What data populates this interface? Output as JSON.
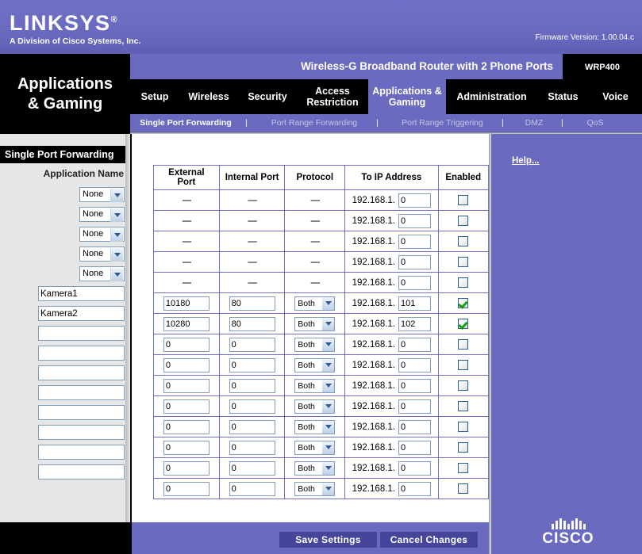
{
  "brand": {
    "name": "LINKSYS",
    "registered": "®",
    "tagline": "A Division of Cisco Systems, Inc.",
    "firmware": "Firmware Version: 1.00.04.c",
    "cisco_wordmark": "CISCO",
    "banner_color": "#6a6ac0"
  },
  "product": {
    "title": "Wireless-G Broadband Router with 2 Phone Ports",
    "model": "WRP400"
  },
  "nav": {
    "tabs": [
      {
        "label": "Setup",
        "active": false
      },
      {
        "label": "Wireless",
        "active": false
      },
      {
        "label": "Security",
        "active": false
      },
      {
        "label": "Access Restriction",
        "active": false
      },
      {
        "label": "Applications & Gaming",
        "active": true
      },
      {
        "label": "Administration",
        "active": false
      },
      {
        "label": "Status",
        "active": false
      },
      {
        "label": "Voice",
        "active": false
      }
    ],
    "subtabs": [
      {
        "label": "Single Port Forwarding",
        "active": true
      },
      {
        "label": "Port Range Forwarding",
        "active": false
      },
      {
        "label": "Port Range Triggering",
        "active": false
      },
      {
        "label": "DMZ",
        "active": false
      },
      {
        "label": "QoS",
        "active": false
      }
    ],
    "separator": "|"
  },
  "sidebar": {
    "page_title_line1": "Applications",
    "page_title_line2": "& Gaming",
    "section_title": "Single Port Forwarding",
    "application_name_label": "Application Name",
    "rows": [
      {
        "type": "select",
        "value": "None"
      },
      {
        "type": "select",
        "value": "None"
      },
      {
        "type": "select",
        "value": "None"
      },
      {
        "type": "select",
        "value": "None"
      },
      {
        "type": "select",
        "value": "None"
      },
      {
        "type": "text",
        "value": "Kamera1"
      },
      {
        "type": "text",
        "value": "Kamera2"
      },
      {
        "type": "text",
        "value": ""
      },
      {
        "type": "text",
        "value": ""
      },
      {
        "type": "text",
        "value": ""
      },
      {
        "type": "text",
        "value": ""
      },
      {
        "type": "text",
        "value": ""
      },
      {
        "type": "text",
        "value": ""
      },
      {
        "type": "text",
        "value": ""
      },
      {
        "type": "text",
        "value": ""
      }
    ]
  },
  "table": {
    "headers": [
      "External Port",
      "Internal Port",
      "Protocol",
      "To IP Address",
      "Enabled"
    ],
    "ip_prefix": "192.168.1.",
    "dash": "----",
    "rows": [
      {
        "external": "----",
        "internal": "----",
        "protocol": "----",
        "editable": false,
        "ip_last": "0",
        "enabled": false
      },
      {
        "external": "----",
        "internal": "----",
        "protocol": "----",
        "editable": false,
        "ip_last": "0",
        "enabled": false
      },
      {
        "external": "----",
        "internal": "----",
        "protocol": "----",
        "editable": false,
        "ip_last": "0",
        "enabled": false
      },
      {
        "external": "----",
        "internal": "----",
        "protocol": "----",
        "editable": false,
        "ip_last": "0",
        "enabled": false
      },
      {
        "external": "----",
        "internal": "----",
        "protocol": "----",
        "editable": false,
        "ip_last": "0",
        "enabled": false
      },
      {
        "external": "10180",
        "internal": "80",
        "protocol": "Both",
        "editable": true,
        "ip_last": "101",
        "enabled": true
      },
      {
        "external": "10280",
        "internal": "80",
        "protocol": "Both",
        "editable": true,
        "ip_last": "102",
        "enabled": true
      },
      {
        "external": "0",
        "internal": "0",
        "protocol": "Both",
        "editable": true,
        "ip_last": "0",
        "enabled": false
      },
      {
        "external": "0",
        "internal": "0",
        "protocol": "Both",
        "editable": true,
        "ip_last": "0",
        "enabled": false
      },
      {
        "external": "0",
        "internal": "0",
        "protocol": "Both",
        "editable": true,
        "ip_last": "0",
        "enabled": false
      },
      {
        "external": "0",
        "internal": "0",
        "protocol": "Both",
        "editable": true,
        "ip_last": "0",
        "enabled": false
      },
      {
        "external": "0",
        "internal": "0",
        "protocol": "Both",
        "editable": true,
        "ip_last": "0",
        "enabled": false
      },
      {
        "external": "0",
        "internal": "0",
        "protocol": "Both",
        "editable": true,
        "ip_last": "0",
        "enabled": false
      },
      {
        "external": "0",
        "internal": "0",
        "protocol": "Both",
        "editable": true,
        "ip_last": "0",
        "enabled": false
      },
      {
        "external": "0",
        "internal": "0",
        "protocol": "Both",
        "editable": true,
        "ip_last": "0",
        "enabled": false
      }
    ]
  },
  "help": {
    "label": "Help..."
  },
  "buttons": {
    "save": "Save Settings",
    "cancel": "Cancel Changes"
  }
}
